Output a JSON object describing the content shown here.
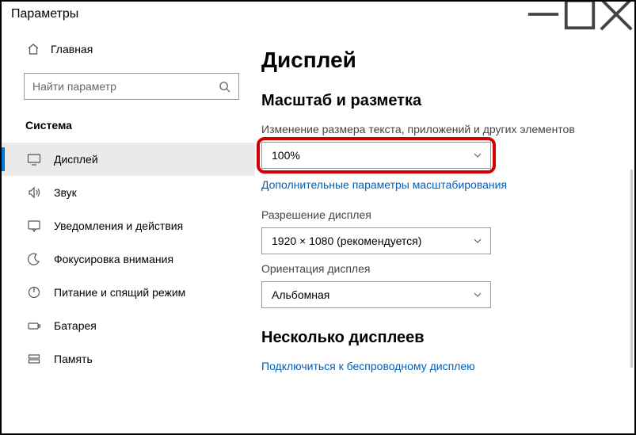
{
  "window": {
    "title": "Параметры"
  },
  "sidebar": {
    "home": "Главная",
    "search_placeholder": "Найти параметр",
    "category": "Система",
    "items": [
      {
        "label": "Дисплей"
      },
      {
        "label": "Звук"
      },
      {
        "label": "Уведомления и действия"
      },
      {
        "label": "Фокусировка внимания"
      },
      {
        "label": "Питание и спящий режим"
      },
      {
        "label": "Батарея"
      },
      {
        "label": "Память"
      }
    ]
  },
  "main": {
    "title": "Дисплей",
    "section_scale": "Масштаб и разметка",
    "scale_label": "Изменение размера текста, приложений и других элементов",
    "scale_value": "100%",
    "scale_link": "Дополнительные параметры масштабирования",
    "resolution_label": "Разрешение дисплея",
    "resolution_value": "1920 × 1080 (рекомендуется)",
    "orientation_label": "Ориентация дисплея",
    "orientation_value": "Альбомная",
    "section_multi": "Несколько дисплеев",
    "multi_link": "Подключиться к беспроводному дисплею"
  }
}
